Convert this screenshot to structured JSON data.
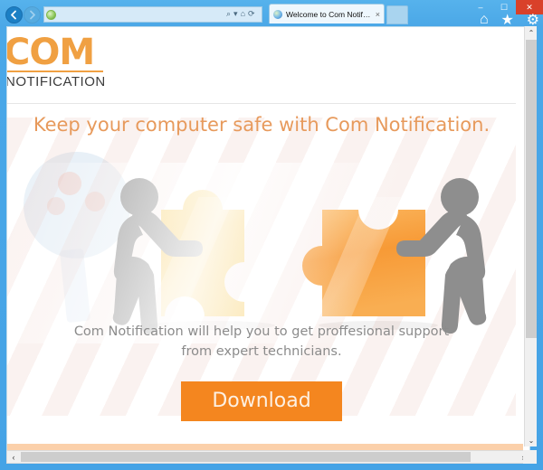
{
  "browser": {
    "name": "Internet Explorer",
    "address_value": "",
    "address_placeholder": "",
    "tab_title": "Welcome to Com Notification",
    "tab_close_glyph": "×",
    "back_label": "Back",
    "forward_label": "Forward",
    "search_icon": "⌕",
    "dropdown_icon": "▾",
    "lock_icon": "⌂",
    "refresh_icon": "⟳",
    "home_icon": "⌂",
    "favorites_icon": "★",
    "tools_icon": "⚙",
    "minimize_glyph": "–",
    "maximize_glyph": "☐",
    "close_glyph": "✕",
    "newtab_label": ""
  },
  "page": {
    "logo": {
      "primary": "COM",
      "secondary": "NOTIFICATION"
    },
    "headline": "Keep your computer safe with Com Notification.",
    "body": "Com Notification will help you to get proffesional support from expert technicians.",
    "download_label": "Download",
    "graphic": {
      "name": "two-people-pushing-puzzle-pieces",
      "left_figure": "gray-stick-figure-pushing-right",
      "right_figure": "gray-stick-figure-pushing-left",
      "left_piece": "yellow-puzzle-piece",
      "right_piece": "orange-puzzle-piece"
    }
  },
  "colors": {
    "accent_orange": "#f4861f",
    "logo_orange": "#f0a042",
    "headline_orange": "#e79a5c",
    "body_gray": "#8b8b8b",
    "chrome_blue": "#4aa8e8",
    "close_red": "#d9412a",
    "puzzle_yellow": "#f7cf63",
    "puzzle_orange": "#f59b3c",
    "figure_gray": "#8e8e8e"
  },
  "scrollbars": {
    "vertical_up": "⌃",
    "vertical_down": "⌄",
    "horizontal_left": "‹",
    "horizontal_right": "›"
  }
}
